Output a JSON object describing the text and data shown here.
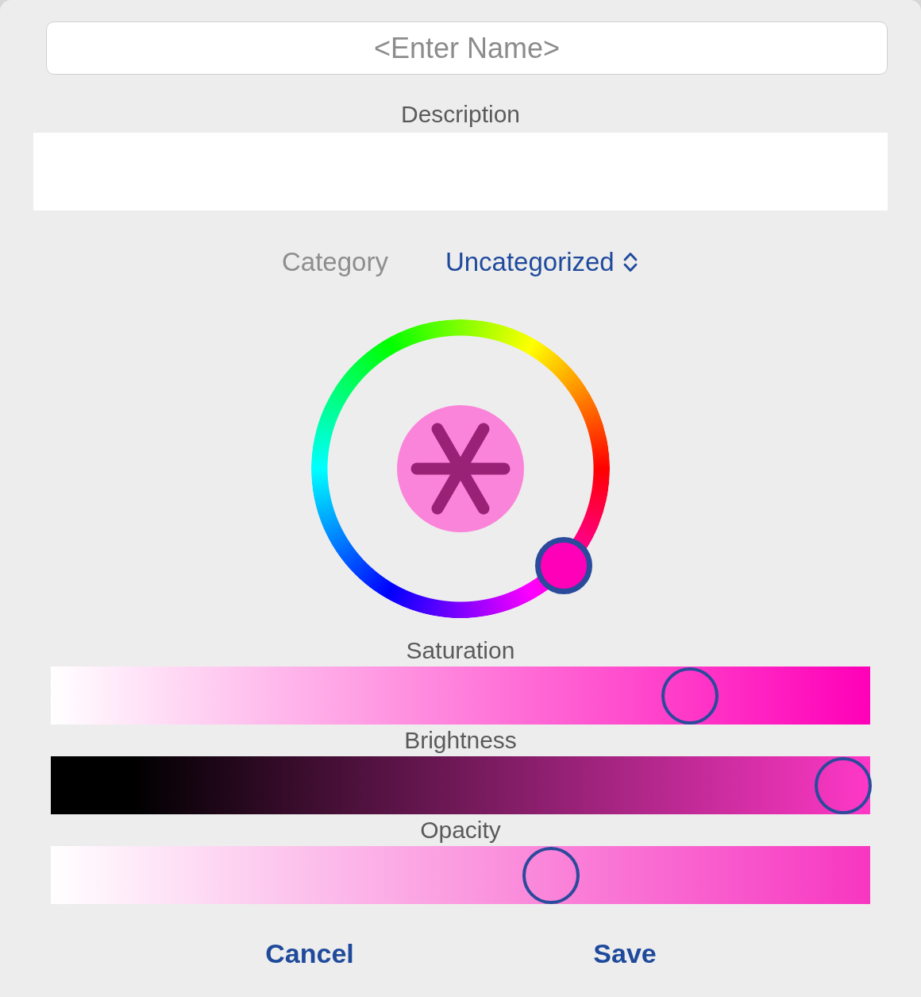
{
  "name_field": {
    "placeholder": "<Enter Name>"
  },
  "description": {
    "label": "Description"
  },
  "category": {
    "label": "Category",
    "value": "Uncategorized"
  },
  "hue_wheel": {
    "level": 0.88
  },
  "sliders": [
    {
      "kind": "saturation",
      "label": "Saturation",
      "level": 0.78
    },
    {
      "kind": "brightness",
      "label": "Brightness",
      "level": 0.967
    },
    {
      "kind": "opacity",
      "label": "Opacity",
      "level": 0.61
    }
  ],
  "buttons": [
    "Cancel",
    "Save"
  ]
}
